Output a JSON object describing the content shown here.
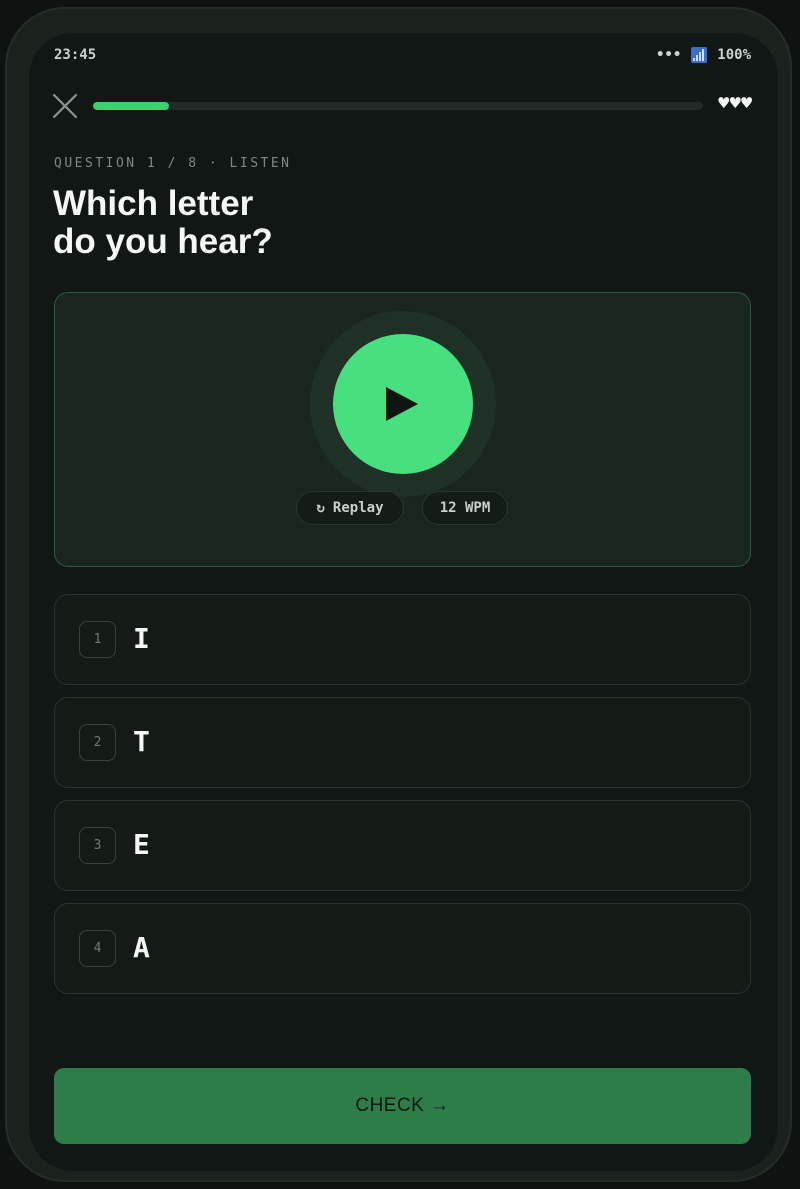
{
  "status": {
    "time": "23:45",
    "dots": "•••",
    "battery": "100%"
  },
  "nav": {
    "progress_fraction": 0.125,
    "hearts": "♥♥♥"
  },
  "question": {
    "eyebrow": "QUESTION 1 / 8 · LISTEN",
    "title_line1": "Which letter",
    "title_line2": "do you hear?"
  },
  "audio": {
    "replay_icon": "↻",
    "replay_label": "Replay",
    "speed": "12 WPM"
  },
  "options": [
    {
      "num": "1",
      "letter": "I"
    },
    {
      "num": "2",
      "letter": "T"
    },
    {
      "num": "3",
      "letter": "E"
    },
    {
      "num": "4",
      "letter": "A"
    }
  ],
  "footer": {
    "check_label": "CHECK →"
  },
  "colors": {
    "accent": "#47df7f",
    "check_bg": "#2e7c48",
    "background": "#111714"
  }
}
